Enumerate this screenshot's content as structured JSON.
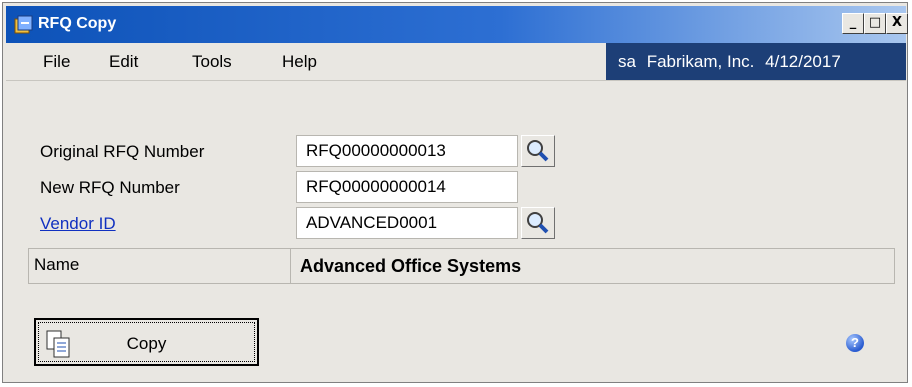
{
  "window": {
    "title": "RFQ Copy",
    "controls": [
      "_",
      "□",
      "X"
    ]
  },
  "menu": {
    "items": [
      {
        "label": "File"
      },
      {
        "label": "Edit"
      },
      {
        "label": "Tools"
      },
      {
        "label": "Help"
      }
    ]
  },
  "status": {
    "user": "sa",
    "company": "Fabrikam, Inc.",
    "date": "4/12/2017"
  },
  "form": {
    "original_rfq_label": "Original RFQ Number",
    "original_rfq_value": "RFQ00000000013",
    "new_rfq_label": "New RFQ Number",
    "new_rfq_value": "RFQ00000000014",
    "vendor_label": "Vendor ID",
    "vendor_value": "ADVANCED0001",
    "name_label": "Name",
    "name_value": "Advanced Office Systems"
  },
  "actions": {
    "copy_label": "Copy"
  },
  "icons": {
    "lookup": "magnifier-icon",
    "help": "help-icon",
    "copy": "copy-document-icon"
  },
  "colors": {
    "titlebar": "#0d52b8",
    "status_panel": "#1d3f77",
    "link": "#1030c0"
  }
}
